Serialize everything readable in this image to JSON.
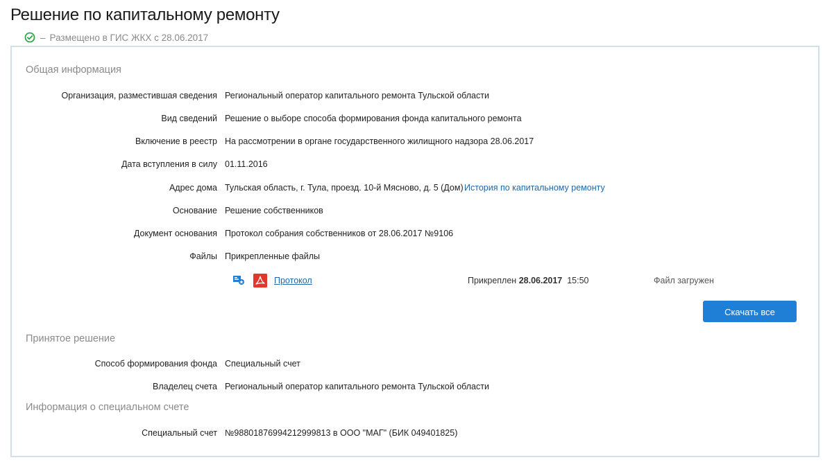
{
  "page_title": "Решение по капитальному ремонту",
  "status": {
    "dash": "–",
    "text": "Размещено в ГИС ЖКХ с 28.06.2017"
  },
  "general": {
    "title": "Общая информация",
    "rows": [
      {
        "label": "Организация, разместившая сведения",
        "value": "Региональный оператор капитального ремонта Тульской области"
      },
      {
        "label": "Вид сведений",
        "value": "Решение о выборе способа формирования фонда капитального ремонта"
      },
      {
        "label": "Включение в реестр",
        "value": "На рассмотрении в органе государственного жилищного надзора 28.06.2017"
      },
      {
        "label": "Дата вступления в силу",
        "value": "01.11.2016"
      },
      {
        "label": "Адрес дома",
        "value": "Тульская область, г. Тула, проезд. 10-й Мясново, д. 5 (Дом)",
        "link": "История по капитальному ремонту"
      },
      {
        "label": "Основание",
        "value": "Решение собственников"
      },
      {
        "label": "Документ основания",
        "value": "Протокол собрания собственников от 28.06.2017 №9106"
      },
      {
        "label": "Файлы",
        "value": "Прикрепленные файлы"
      }
    ],
    "file": {
      "name": "Протокол",
      "attached_prefix": "Прикреплен",
      "attached_date": "28.06.2017",
      "attached_time": "15:50",
      "status": "Файл загружен"
    },
    "download_all": "Скачать все"
  },
  "decision": {
    "title": "Принятое решение",
    "rows": [
      {
        "label": "Способ формирования фонда",
        "value": "Специальный счет"
      },
      {
        "label": "Владелец счета",
        "value": "Региональный оператор капитального ремонта Тульской области"
      }
    ]
  },
  "special_account": {
    "title": "Информация о специальном счете",
    "rows": [
      {
        "label": "Специальный счет",
        "value": "№98801876994212999813 в ООО \"МАГ\" (БИК 049401825)"
      }
    ]
  },
  "icons": {
    "status": "check-circle-icon",
    "signature": "digital-signature-icon",
    "file_type": "pdf-icon"
  },
  "colors": {
    "accent": "#1f7fd6",
    "link": "#1f67a8",
    "success": "#2aa84a",
    "pdf": "#e2382b",
    "border": "#cfe0ea"
  }
}
